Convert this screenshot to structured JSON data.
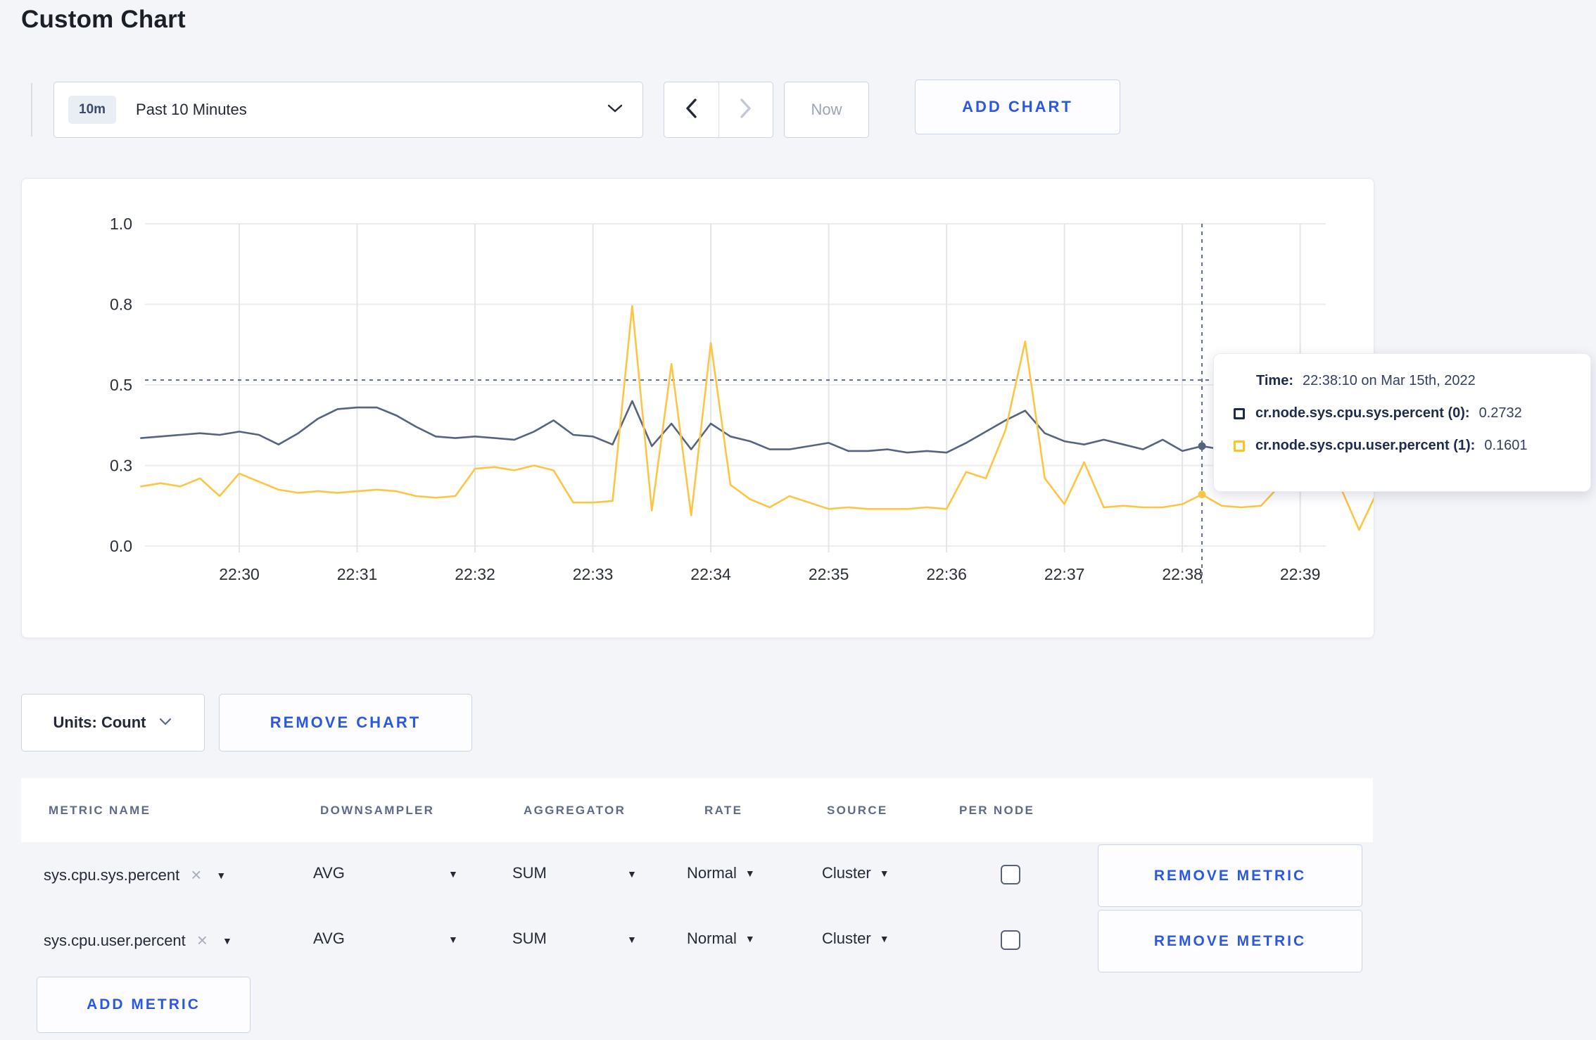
{
  "page": {
    "title": "Custom Chart"
  },
  "toolbar": {
    "time_window_badge": "10m",
    "time_window_label": "Past 10 Minutes",
    "now_label": "Now",
    "add_chart_label": "ADD CHART"
  },
  "icons": {
    "close": "×",
    "caret_down": "▼"
  },
  "chart_data": {
    "type": "line",
    "title": "",
    "x_tick_labels": [
      "22:30",
      "22:31",
      "22:32",
      "22:33",
      "22:34",
      "22:35",
      "22:36",
      "22:37",
      "22:38",
      "22:39"
    ],
    "y_tick_values": [
      0,
      0.25,
      0.5,
      0.75,
      1.0
    ],
    "y_tick_labels": [
      "0.0",
      "0.3",
      "0.5",
      "0.8",
      "1.0"
    ],
    "ylim": [
      0,
      1
    ],
    "grid": true,
    "legend_position": "tooltip",
    "x_start": "22:29:10",
    "x_interval_seconds": 10,
    "crosshair": {
      "x_time": "22:38:10",
      "guide_y_value": 0.515
    },
    "series": [
      {
        "name": "cr.node.sys.cpu.sys.percent (0)",
        "color": "#57647e",
        "values": [
          0.335,
          0.34,
          0.345,
          0.35,
          0.345,
          0.355,
          0.345,
          0.315,
          0.35,
          0.395,
          0.425,
          0.43,
          0.43,
          0.405,
          0.37,
          0.34,
          0.335,
          0.34,
          0.335,
          0.33,
          0.355,
          0.39,
          0.345,
          0.34,
          0.315,
          0.45,
          0.31,
          0.38,
          0.3,
          0.38,
          0.34,
          0.325,
          0.3,
          0.3,
          0.31,
          0.32,
          0.295,
          0.295,
          0.3,
          0.29,
          0.295,
          0.29,
          0.32,
          0.355,
          0.39,
          0.42,
          0.35,
          0.325,
          0.315,
          0.33,
          0.315,
          0.3,
          0.33,
          0.295,
          0.31,
          0.3,
          0.295,
          0.305,
          0.3,
          0.31,
          0.305,
          0.31,
          0.3,
          0.31
        ]
      },
      {
        "name": "cr.node.sys.cpu.user.percent (1)",
        "color": "#fcc546",
        "values": [
          0.185,
          0.195,
          0.185,
          0.21,
          0.155,
          0.225,
          0.2,
          0.175,
          0.165,
          0.17,
          0.165,
          0.17,
          0.175,
          0.17,
          0.155,
          0.15,
          0.155,
          0.24,
          0.245,
          0.235,
          0.25,
          0.235,
          0.135,
          0.135,
          0.14,
          0.745,
          0.11,
          0.565,
          0.095,
          0.63,
          0.19,
          0.145,
          0.12,
          0.155,
          0.135,
          0.115,
          0.12,
          0.115,
          0.115,
          0.115,
          0.12,
          0.115,
          0.23,
          0.21,
          0.36,
          0.635,
          0.21,
          0.13,
          0.26,
          0.12,
          0.125,
          0.12,
          0.12,
          0.13,
          0.16,
          0.125,
          0.12,
          0.125,
          0.19,
          0.21,
          0.21,
          0.19,
          0.05,
          0.18
        ]
      }
    ]
  },
  "tooltip": {
    "time_label": "Time:",
    "time_value": "22:38:10 on Mar 15th, 2022",
    "series": [
      {
        "name": "cr.node.sys.cpu.sys.percent (0):",
        "value": "0.2732",
        "swatch_color": "#1f2b4a"
      },
      {
        "name": "cr.node.sys.cpu.user.percent (1):",
        "value": "0.1601",
        "swatch_color": "#ffc31e"
      }
    ]
  },
  "chart_controls": {
    "units_label": "Units: Count",
    "remove_chart_label": "REMOVE CHART"
  },
  "metrics_table": {
    "headers": [
      "METRIC NAME",
      "DOWNSAMPLER",
      "AGGREGATOR",
      "RATE",
      "SOURCE",
      "PER NODE"
    ],
    "rows": [
      {
        "metric_name": "sys.cpu.sys.percent",
        "downsampler": "AVG",
        "aggregator": "SUM",
        "rate": "Normal",
        "source": "Cluster",
        "per_node_checked": false,
        "remove_label": "REMOVE METRIC"
      },
      {
        "metric_name": "sys.cpu.user.percent",
        "downsampler": "AVG",
        "aggregator": "SUM",
        "rate": "Normal",
        "source": "Cluster",
        "per_node_checked": false,
        "remove_label": "REMOVE METRIC"
      }
    ],
    "add_metric_label": "ADD METRIC"
  }
}
